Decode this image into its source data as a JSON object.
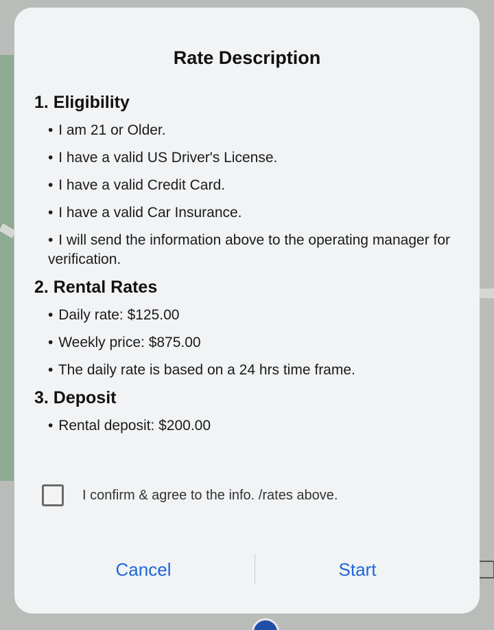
{
  "dialog": {
    "title": "Rate Description",
    "sections": [
      {
        "title": "1. Eligibility",
        "items": [
          "I am 21 or Older.",
          "I have a valid US Driver's License.",
          "I have a valid Credit Card.",
          "I have a valid Car Insurance.",
          "I will send the information above to the operating manager for verification."
        ]
      },
      {
        "title": "2. Rental Rates",
        "items": [
          "Daily rate: $125.00",
          "Weekly price: $875.00",
          "The daily rate is based on a 24 hrs time frame."
        ]
      },
      {
        "title": "3. Deposit",
        "items": [
          "Rental deposit: $200.00"
        ]
      }
    ],
    "bullet": "•",
    "confirm": {
      "label": "I confirm & agree to the info. /rates above.",
      "checked": false
    },
    "buttons": {
      "cancel": "Cancel",
      "start": "Start"
    }
  },
  "colors": {
    "accent": "#1f66d6",
    "dialog_bg": "#f1f3f5"
  }
}
